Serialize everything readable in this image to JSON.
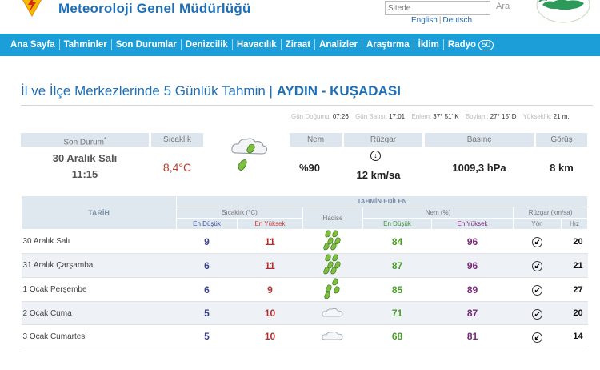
{
  "header": {
    "site_title": "Meteoroloji Genel Müdürlüğü",
    "search_placeholder": "Sitede",
    "search_button": "Ara",
    "lang_english": "English",
    "lang_deutsch": "Deutsch"
  },
  "nav": {
    "items": [
      "Ana Sayfa",
      "Tahminler",
      "Son Durumlar",
      "Denizcilik",
      "Havacılık",
      "Ziraat",
      "Analizler",
      "Araştırma",
      "İklim",
      "Radyo"
    ],
    "radio_badge": "50"
  },
  "page": {
    "title_prefix": "İl ve İlçe Merkezlerinde 5 Günlük Tahmin | ",
    "location": "AYDIN - KUŞADASI"
  },
  "sun_info": {
    "sunrise_label": "Gün Doğumu:",
    "sunrise": "07:26",
    "sunset_label": "Gün Batışı:",
    "sunset": "17:01",
    "lat_label": "Enlem:",
    "lat": "37° 51' K",
    "lon_label": "Boylam:",
    "lon": "27° 15' D",
    "alt_label": "Yükseklik:",
    "alt": "21 m."
  },
  "current": {
    "status_header": "Son Durum",
    "status_marker": "*",
    "date": "30 Aralık Salı",
    "time": "11:15",
    "temp_header": "Sıcaklık",
    "temp": "8,4°C",
    "humidity_header": "Nem",
    "humidity": "%90",
    "wind_header": "Rüzgar",
    "wind_dir_icon": "wind-arrow-down-icon",
    "wind": "12 km/sa",
    "pressure_header": "Basınç",
    "pressure": "1009,3 hPa",
    "visibility_header": "Görüş",
    "visibility": "8 km",
    "weather_icon": "cloud-rain-icon"
  },
  "forecast": {
    "header_date": "TARİH",
    "header_predicted": "TAHMİN EDİLEN",
    "header_temp": "Sıcaklık (°C)",
    "header_event": "Hadise",
    "header_humidity": "Nem (%)",
    "header_wind": "Rüzgar (km/sa)",
    "sub_min": "En Düşük",
    "sub_max": "En Yüksek",
    "sub_hmin": "En Düşük",
    "sub_hmax": "En Yüksek",
    "sub_dir": "Yön",
    "sub_speed": "Hız",
    "rows": [
      {
        "date": "30 Aralık Salı",
        "tmin": "9",
        "tmax": "11",
        "event": "heavy-rain-icon",
        "hmin": "84",
        "hmax": "96",
        "dir": "arrow-southwest-icon",
        "speed": "20"
      },
      {
        "date": "31 Aralık Çarşamba",
        "tmin": "6",
        "tmax": "11",
        "event": "heavy-rain-icon",
        "hmin": "87",
        "hmax": "96",
        "dir": "arrow-southwest-icon",
        "speed": "21"
      },
      {
        "date": "1 Ocak Perşembe",
        "tmin": "6",
        "tmax": "9",
        "event": "rain-icon",
        "hmin": "85",
        "hmax": "89",
        "dir": "arrow-southwest-icon",
        "speed": "27"
      },
      {
        "date": "2 Ocak Cuma",
        "tmin": "5",
        "tmax": "10",
        "event": "cloud-icon",
        "hmin": "71",
        "hmax": "87",
        "dir": "arrow-southwest-icon",
        "speed": "20"
      },
      {
        "date": "3 Ocak Cumartesi",
        "tmin": "5",
        "tmax": "10",
        "event": "cloud-icon",
        "hmin": "68",
        "hmax": "81",
        "dir": "arrow-southwest-icon",
        "speed": "14"
      }
    ]
  },
  "colors": {
    "nav_bg": "#1c9ed9",
    "title_blue": "#1f6fb6",
    "header_bg": "#e0e8ef"
  }
}
